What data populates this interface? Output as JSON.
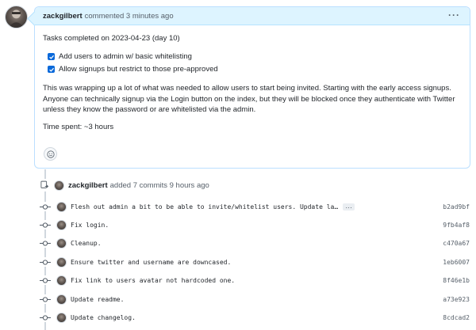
{
  "comment": {
    "author": "zackgilbert",
    "action": "commented",
    "time": "3 minutes ago",
    "menu_icon": "kebab-horizontal-icon",
    "heading": "Tasks completed on 2023-04-23 (day 10)",
    "tasks": [
      {
        "label": "Add users to admin w/ basic whitelisting",
        "checked": true
      },
      {
        "label": "Allow signups but restrict to those pre-approved",
        "checked": true
      }
    ],
    "paragraph": "This was wrapping up a lot of what was needed to allow users to start being invited. Starting with the early access signups. Anyone can technically signup via the Login button on the index, but they will be blocked once they authenticate with Twitter unless they know the password or are whitelisted via the admin.",
    "time_spent": "Time spent: ~3 hours",
    "reaction_icon": "smiley-icon"
  },
  "commits_event": {
    "author": "zackgilbert",
    "action": "added 7 commits",
    "time": "9 hours ago",
    "icon": "repo-push-icon"
  },
  "commits": [
    {
      "message": "Flesh out admin a bit to be able to invite/whitelist users. Update la…",
      "sha": "b2ad9bf",
      "has_more": true,
      "more_label": "…"
    },
    {
      "message": "Fix login.",
      "sha": "9fb4af8"
    },
    {
      "message": "Cleanup.",
      "sha": "c470a67"
    },
    {
      "message": "Ensure twitter and username are downcased.",
      "sha": "1eb6007"
    },
    {
      "message": "Fix link to users avatar not hardcoded one.",
      "sha": "8f46e1b"
    },
    {
      "message": "Update readme.",
      "sha": "a73e923"
    },
    {
      "message": "Update changelog.",
      "sha": "8cdcad2"
    }
  ],
  "colors": {
    "header_bg": "#ddf4ff",
    "checkbox": "#0969da",
    "muted_text": "#57606a"
  }
}
